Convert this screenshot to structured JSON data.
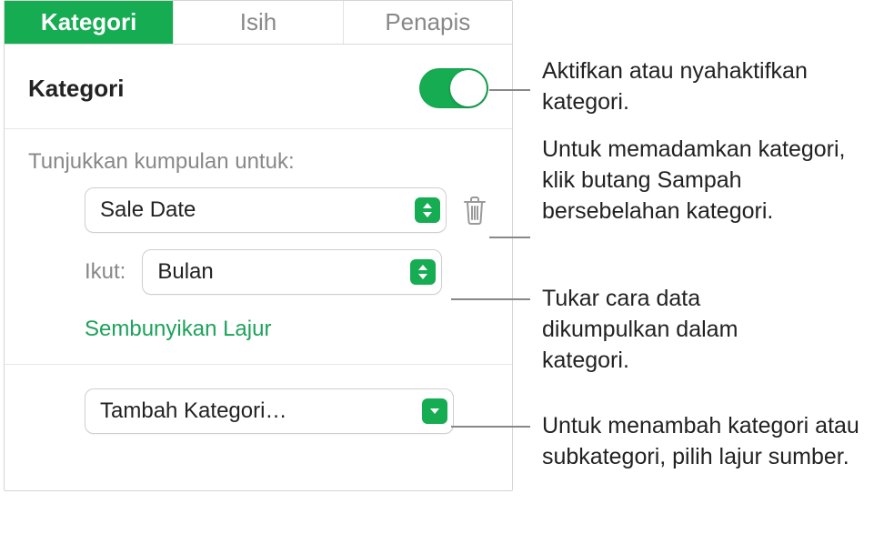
{
  "tabs": {
    "kategori": "Kategori",
    "isih": "Isih",
    "penapis": "Penapis"
  },
  "section": {
    "title": "Kategori"
  },
  "groups": {
    "label": "Tunjukkan kumpulan untuk:",
    "source": "Sale Date",
    "by_label": "Ikut:",
    "by_value": "Bulan",
    "hide_column": "Sembunyikan Lajur"
  },
  "add": {
    "label": "Tambah Kategori…"
  },
  "callouts": {
    "toggle": "Aktifkan atau nyahaktifkan kategori.",
    "delete": "Untuk memadamkan kategori, klik butang Sampah bersebelahan kategori.",
    "group": "Tukar cara data dikumpulkan dalam kategori.",
    "add": "Untuk menambah kategori atau subkategori, pilih lajur sumber."
  }
}
